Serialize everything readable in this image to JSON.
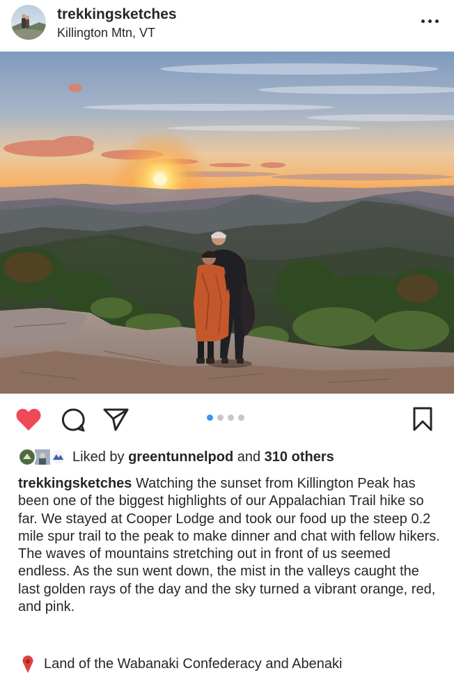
{
  "post": {
    "username": "trekkingsketches",
    "location": "Killington Mtn, VT",
    "photo_alt": "Two hikers standing on a rocky summit at sunset with mountain ranges behind them",
    "carousel": {
      "count": 4,
      "active": 1
    },
    "likes": {
      "prefix": "Liked by",
      "user": "greentunnelpod",
      "middle": "and",
      "others": "310 others"
    },
    "caption": {
      "user": "trekkingsketches",
      "text": "Watching the sunset from Killington Peak has been one of the biggest highlights of our Appalachian Trail hike so far. We stayed at Cooper Lodge and took our food up the steep 0.2 mile spur trail to the peak to make dinner and chat with fellow hikers. The waves of mountains stretching out in front of us seemed endless. As the sun went down, the mist in the valleys caught the last golden rays of the day and the sky turned a vibrant orange, red, and pink."
    },
    "land": "Land of the Wabanaki Confederacy and Abenaki"
  },
  "icons": {
    "more": "more-options-icon",
    "like": "heart-icon",
    "comment": "comment-icon",
    "share": "send-icon",
    "save": "bookmark-icon",
    "pin": "location-pin-icon"
  },
  "colors": {
    "liked_heart": "#ed4956",
    "carousel_active": "#3897f0",
    "carousel_inactive": "#c7c7c7",
    "text": "#262626"
  }
}
